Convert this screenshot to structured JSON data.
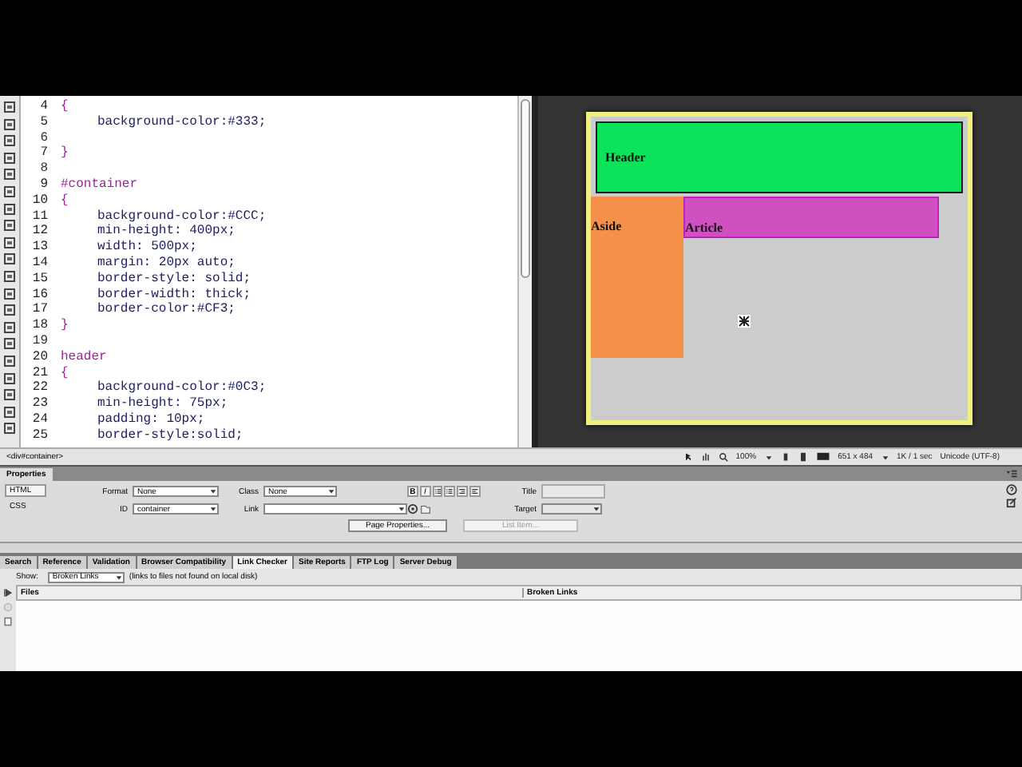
{
  "code": {
    "lines": [
      {
        "number": "4",
        "kind": "brace",
        "text": "{"
      },
      {
        "number": "5",
        "kind": "declaration",
        "text": "background-color:#333;"
      },
      {
        "number": "6",
        "kind": "blank"
      },
      {
        "number": "7",
        "kind": "brace",
        "text": "}"
      },
      {
        "number": "8",
        "kind": "blank"
      },
      {
        "number": "9",
        "kind": "selector",
        "text": "#container"
      },
      {
        "number": "10",
        "kind": "brace",
        "text": "{"
      },
      {
        "number": "11",
        "kind": "declaration",
        "text": "background-color:#CCC;"
      },
      {
        "number": "12",
        "kind": "declaration",
        "text": "min-height: 400px;"
      },
      {
        "number": "13",
        "kind": "declaration",
        "text": "width: 500px;"
      },
      {
        "number": "14",
        "kind": "declaration",
        "text": "margin: 20px auto;"
      },
      {
        "number": "15",
        "kind": "declaration",
        "text": "border-style: solid;"
      },
      {
        "number": "16",
        "kind": "declaration",
        "text": "border-width: thick;"
      },
      {
        "number": "17",
        "kind": "declaration",
        "text": "border-color:#CF3;"
      },
      {
        "number": "18",
        "kind": "brace",
        "text": "}"
      },
      {
        "number": "19",
        "kind": "blank"
      },
      {
        "number": "20",
        "kind": "selector",
        "text": "header"
      },
      {
        "number": "21",
        "kind": "brace",
        "text": "{"
      },
      {
        "number": "22",
        "kind": "declaration",
        "text": "background-color:#0C3;"
      },
      {
        "number": "23",
        "kind": "declaration",
        "text": "min-height: 75px;"
      },
      {
        "number": "24",
        "kind": "declaration",
        "text": "padding: 10px;"
      },
      {
        "number": "25",
        "kind": "declaration",
        "text": "border-style:solid;"
      }
    ]
  },
  "design": {
    "header": "Header",
    "aside": "Aside",
    "article": "Article"
  },
  "status_bar": {
    "tag": "<div#container>",
    "zoom": "100%",
    "size": "651 x 484",
    "download": "1K / 1 sec",
    "encoding": "Unicode (UTF-8)"
  },
  "properties": {
    "title": "Properties",
    "modes": [
      {
        "label": "HTML",
        "selected": true
      },
      {
        "label": "CSS",
        "selected": false
      }
    ],
    "format": {
      "label": "Format",
      "value": "None"
    },
    "id": {
      "label": "ID",
      "value": "container"
    },
    "class": {
      "label": "Class",
      "value": "None"
    },
    "format_buttons": [
      "B",
      "I"
    ],
    "link": {
      "label": "Link"
    },
    "title_field": {
      "label": "Title"
    },
    "target": {
      "label": "Target"
    },
    "buttons": [
      {
        "label": "Page Properties...",
        "disabled": false
      },
      {
        "label": "List Item...",
        "disabled": true
      }
    ]
  },
  "results": {
    "tabs": [
      {
        "label": "Search",
        "selected": false
      },
      {
        "label": "Reference",
        "selected": false
      },
      {
        "label": "Validation",
        "selected": false
      },
      {
        "label": "Browser Compatibility",
        "selected": false
      },
      {
        "label": "Link Checker",
        "selected": true
      },
      {
        "label": "Site Reports",
        "selected": false
      },
      {
        "label": "FTP Log",
        "selected": false
      },
      {
        "label": "Server Debug",
        "selected": false
      }
    ],
    "show_label": "Show:",
    "show_value": "Broken Links",
    "note": "(links to files not found on local disk)",
    "columns": [
      "Files",
      "Broken Links"
    ]
  }
}
